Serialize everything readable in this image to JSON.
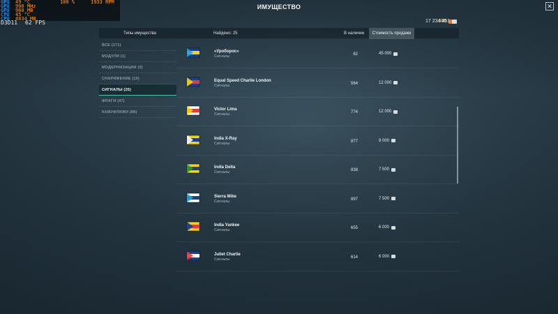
{
  "osd": {
    "rows": [
      {
        "k": "GPU",
        "v": "49 °C"
      },
      {
        "k": "GPU",
        "v": "900 MHz"
      },
      {
        "k": "GPU",
        "v": "960 MB"
      },
      {
        "k": "CPU",
        "v": "45 °C"
      },
      {
        "k": "CPU",
        "v": "4634 MB"
      }
    ],
    "pct": "100 %",
    "rpm": "1933 RPM",
    "fps_label": "D3D11",
    "fps_value": "62 FPS"
  },
  "window": {
    "title": "ИМУЩЕСТВО",
    "close": "✕"
  },
  "currency": {
    "doubloons": "300",
    "credits": "17 234 451"
  },
  "header": {
    "types": "Типы имущества",
    "found": "Найдено: 25",
    "in_stock": "В наличии",
    "sell_price": "Стоимость продажи"
  },
  "sidebar": {
    "items": [
      {
        "label": "ВСЕ (171)"
      },
      {
        "label": "МОДУЛИ (1)"
      },
      {
        "label": "МОДЕРНИЗАЦИИ (0)"
      },
      {
        "label": "СНАРЯЖЕНИЕ (10)"
      },
      {
        "label": "СИГНАЛЫ (25)",
        "active": true
      },
      {
        "label": "ФЛАГИ (47)"
      },
      {
        "label": "КАМУФЛЯЖИ (88)"
      }
    ]
  },
  "items": [
    {
      "name": "«Уроборос»",
      "category": "Сигналы",
      "stock": "82",
      "price": "45 000",
      "flag": "ouroboros-flag-icon",
      "colors": [
        "#1b3f8c",
        "#f2d21a",
        "#2aa0d8"
      ]
    },
    {
      "name": "Equal Speed Charlie London",
      "category": "Сигналы",
      "stock": "564",
      "price": "12 000",
      "flag": "esc-london-flag-icon",
      "colors": [
        "#1b3f8c",
        "#e23b3b",
        "#f2d21a"
      ]
    },
    {
      "name": "Victor Lima",
      "category": "Сигналы",
      "stock": "774",
      "price": "12 000",
      "flag": "victor-lima-flag-icon",
      "colors": [
        "#ffffff",
        "#e23b3b",
        "#f2d21a"
      ]
    },
    {
      "name": "India X-Ray",
      "category": "Сигналы",
      "stock": "877",
      "price": "9 000",
      "flag": "india-xray-flag-icon",
      "colors": [
        "#f2d21a",
        "#1b3f8c",
        "#ffffff"
      ]
    },
    {
      "name": "India Delta",
      "category": "Сигналы",
      "stock": "838",
      "price": "7 500",
      "flag": "india-delta-flag-icon",
      "colors": [
        "#f2d21a",
        "#1b3f8c",
        "#2a9b3a"
      ]
    },
    {
      "name": "Sierra Mike",
      "category": "Сигналы",
      "stock": "897",
      "price": "7 500",
      "flag": "sierra-mike-flag-icon",
      "colors": [
        "#ffffff",
        "#1b3f8c",
        "#2aa0d8"
      ]
    },
    {
      "name": "India Yankee",
      "category": "Сигналы",
      "stock": "655",
      "price": "6 000",
      "flag": "india-yankee-flag-icon",
      "colors": [
        "#f2d21a",
        "#e23b3b",
        "#1b3f8c"
      ]
    },
    {
      "name": "Juliet Charlie",
      "category": "Сигналы",
      "stock": "614",
      "price": "6 000",
      "flag": "juliet-charlie-flag-icon",
      "colors": [
        "#1b3f8c",
        "#ffffff",
        "#e23b3b"
      ]
    }
  ]
}
